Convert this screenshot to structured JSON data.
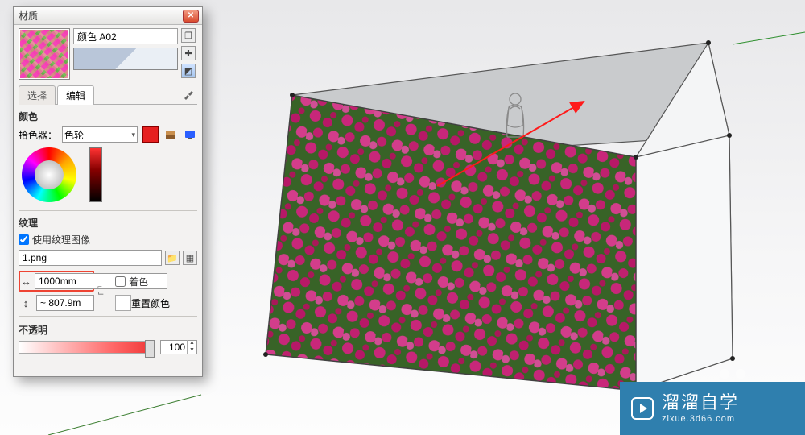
{
  "panel": {
    "title": "材质",
    "material_name": "颜色 A02",
    "tabs": {
      "select": "选择",
      "edit": "编辑"
    },
    "color": {
      "title": "颜色",
      "picker_label": "拾色器：",
      "picker_value": "色轮"
    },
    "texture": {
      "title": "纹理",
      "use_image": "使用纹理图像",
      "file": "1.png",
      "width": "1000mm",
      "height": "~ 807.9m",
      "colorize": "着色",
      "reset": "重置颜色"
    },
    "opacity": {
      "title": "不透明",
      "value": "100"
    }
  },
  "watermark": {
    "cn": "溜溜自学",
    "en": "zixue.3d66.com"
  }
}
